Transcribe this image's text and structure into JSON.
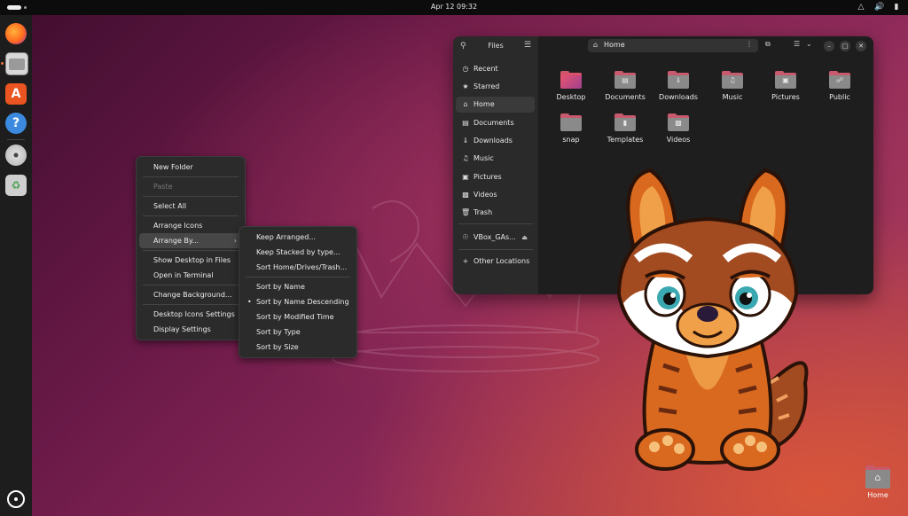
{
  "topbar": {
    "clock": "Apr 12  09:32",
    "tray_icons": [
      "network-icon",
      "volume-icon",
      "battery-icon"
    ]
  },
  "dock": {
    "apps": [
      "firefox",
      "files",
      "app-center",
      "help",
      "dvd",
      "trash"
    ]
  },
  "desktop_menu": {
    "items": [
      {
        "label": "New Folder",
        "enabled": true
      },
      {
        "label": "Paste",
        "enabled": false
      },
      {
        "label": "Select All",
        "enabled": true
      },
      {
        "label": "Arrange Icons",
        "enabled": true
      },
      {
        "label": "Arrange By...",
        "enabled": true,
        "submenu": true
      },
      {
        "label": "Show Desktop in Files",
        "enabled": true
      },
      {
        "label": "Open in Terminal",
        "enabled": true
      },
      {
        "label": "Change Background...",
        "enabled": true
      },
      {
        "label": "Desktop Icons Settings",
        "enabled": true
      },
      {
        "label": "Display Settings",
        "enabled": true
      }
    ]
  },
  "arrange_menu": {
    "items": [
      {
        "label": "Keep Arranged..."
      },
      {
        "label": "Keep Stacked by type..."
      },
      {
        "label": "Sort Home/Drives/Trash..."
      },
      {
        "label": "Sort by Name"
      },
      {
        "label": "Sort by Name Descending",
        "selected": true
      },
      {
        "label": "Sort by Modified Time"
      },
      {
        "label": "Sort by Type"
      },
      {
        "label": "Sort by Size"
      }
    ]
  },
  "files_window": {
    "sidebar_title": "Files",
    "sidebar": [
      {
        "label": "Recent",
        "icon": "clock-icon"
      },
      {
        "label": "Starred",
        "icon": "star-icon"
      },
      {
        "label": "Home",
        "icon": "home-icon",
        "active": true
      },
      {
        "label": "Documents",
        "icon": "document-icon"
      },
      {
        "label": "Downloads",
        "icon": "download-icon"
      },
      {
        "label": "Music",
        "icon": "music-icon"
      },
      {
        "label": "Pictures",
        "icon": "picture-icon"
      },
      {
        "label": "Videos",
        "icon": "video-icon"
      },
      {
        "label": "Trash",
        "icon": "trash-icon"
      },
      {
        "label": "VBox_GAs...",
        "icon": "disc-icon"
      },
      {
        "label": "Other Locations",
        "icon": "plus-icon"
      }
    ],
    "path": "Home",
    "folders": [
      {
        "name": "Desktop"
      },
      {
        "name": "Documents"
      },
      {
        "name": "Downloads"
      },
      {
        "name": "Music"
      },
      {
        "name": "Pictures"
      },
      {
        "name": "Public"
      },
      {
        "name": "snap"
      },
      {
        "name": "Templates"
      },
      {
        "name": "Videos"
      }
    ]
  },
  "desktop_icons": {
    "home_label": "Home"
  }
}
